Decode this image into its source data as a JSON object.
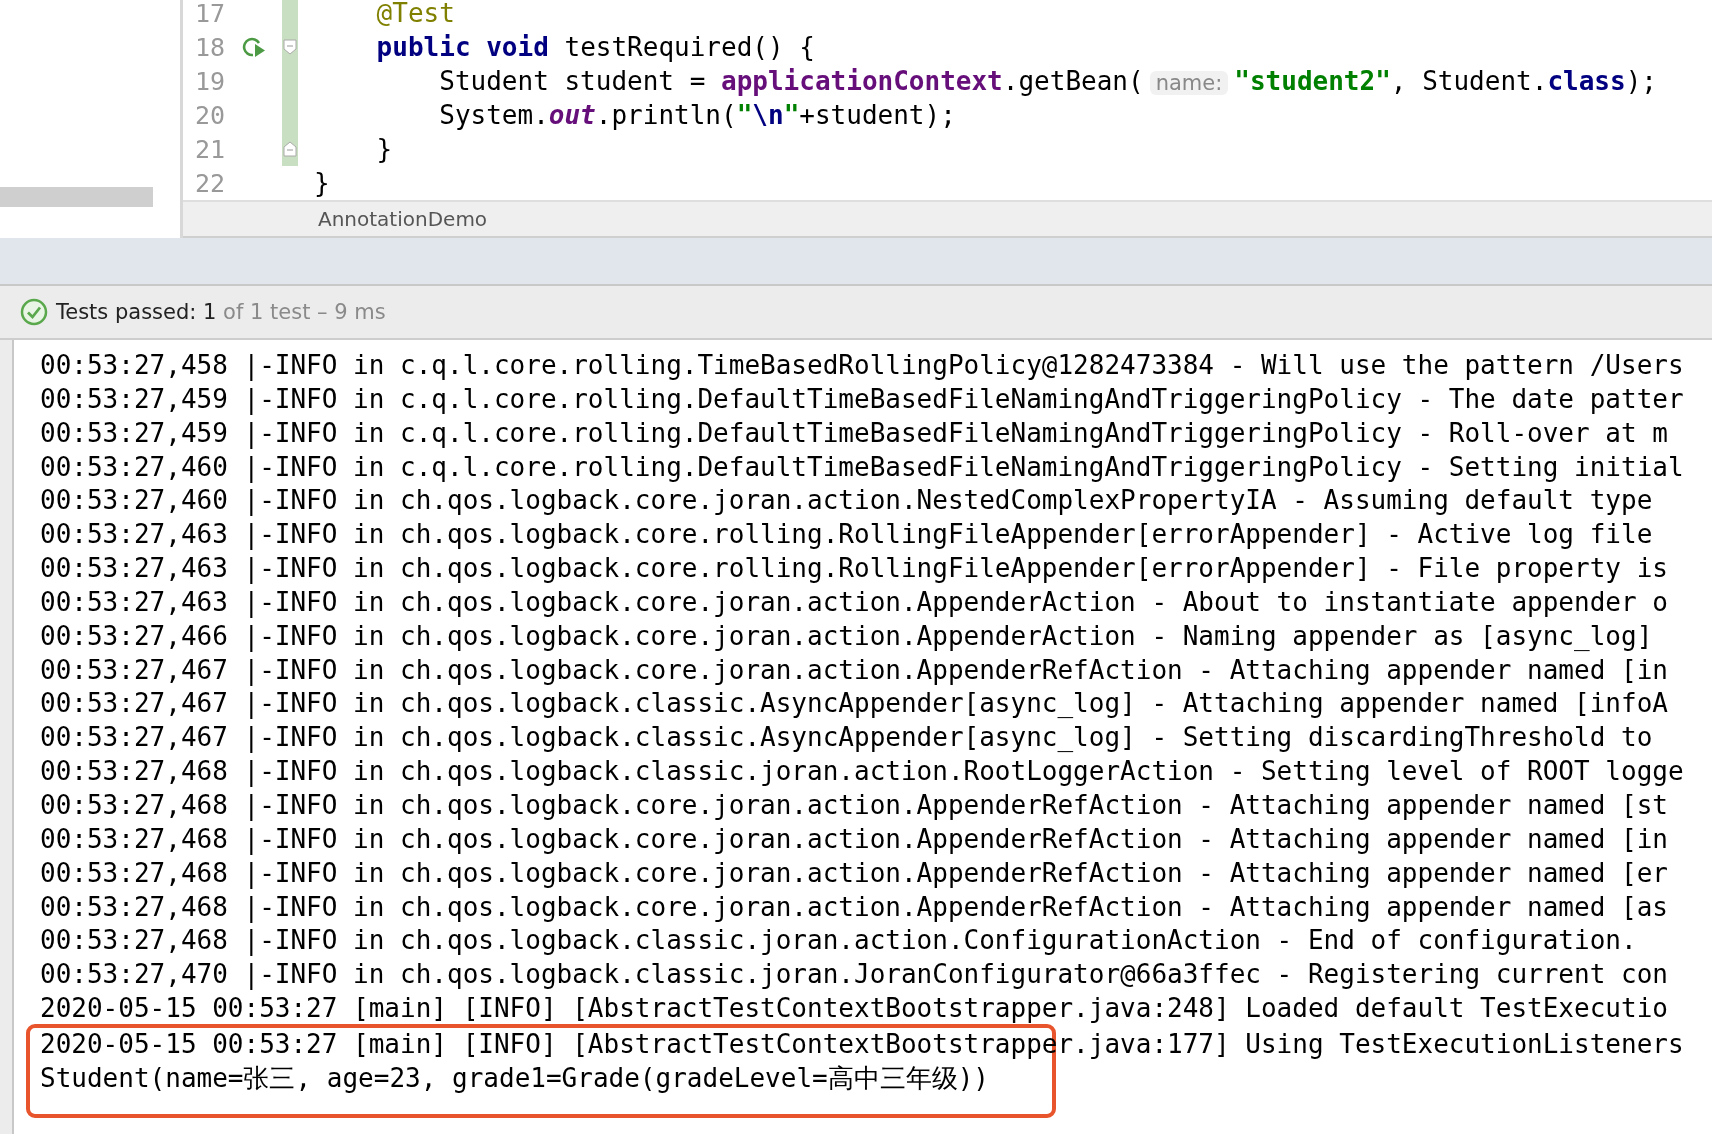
{
  "editor": {
    "lines": [
      {
        "number": "17",
        "changed": true,
        "run_icon": false,
        "fold_open": false,
        "fold_close": false,
        "tokens": [
          {
            "kind": "annotation",
            "text": "    @Test"
          }
        ]
      },
      {
        "number": "18",
        "changed": true,
        "run_icon": true,
        "fold_open": true,
        "fold_close": false,
        "tokens": [
          {
            "kind": "keyword",
            "text": "    public"
          },
          {
            "kind": "keyword",
            "text": " void"
          },
          {
            "kind": "plain",
            "text": " testRequired() {"
          }
        ]
      },
      {
        "number": "19",
        "changed": true,
        "run_icon": false,
        "fold_open": false,
        "fold_close": false,
        "tokens": [
          {
            "kind": "plain",
            "text": "        Student student = "
          },
          {
            "kind": "field",
            "text": "applicationContext"
          },
          {
            "kind": "plain",
            "text": ".getBean("
          },
          {
            "kind": "hint",
            "text": "name:"
          },
          {
            "kind": "string",
            "text": "\"student2\""
          },
          {
            "kind": "plain",
            "text": ", Student."
          },
          {
            "kind": "keyword",
            "text": "class"
          },
          {
            "kind": "plain",
            "text": ");"
          }
        ]
      },
      {
        "number": "20",
        "changed": true,
        "run_icon": false,
        "fold_open": false,
        "fold_close": false,
        "tokens": [
          {
            "kind": "plain",
            "text": "        System."
          },
          {
            "kind": "static",
            "text": "out"
          },
          {
            "kind": "plain",
            "text": ".println("
          },
          {
            "kind": "string",
            "text": "\""
          },
          {
            "kind": "escape",
            "text": "\\n"
          },
          {
            "kind": "string",
            "text": "\""
          },
          {
            "kind": "plain",
            "text": "+student);"
          }
        ]
      },
      {
        "number": "21",
        "changed": true,
        "run_icon": false,
        "fold_open": false,
        "fold_close": true,
        "tokens": [
          {
            "kind": "plain",
            "text": "    }"
          }
        ]
      },
      {
        "number": "22",
        "changed": false,
        "run_icon": false,
        "fold_open": false,
        "fold_close": false,
        "tokens": [
          {
            "kind": "plain",
            "text": "}"
          }
        ]
      }
    ],
    "breadcrumb": "AnnotationDemo"
  },
  "test_status": {
    "passed": true,
    "label": "Tests passed:",
    "count": "1",
    "detail": "of 1 test – 9 ms"
  },
  "console": {
    "lines": [
      "00:53:27,458 |-INFO in c.q.l.core.rolling.TimeBasedRollingPolicy@1282473384 - Will use the pattern /Users",
      "00:53:27,459 |-INFO in c.q.l.core.rolling.DefaultTimeBasedFileNamingAndTriggeringPolicy - The date patter",
      "00:53:27,459 |-INFO in c.q.l.core.rolling.DefaultTimeBasedFileNamingAndTriggeringPolicy - Roll-over at m",
      "00:53:27,460 |-INFO in c.q.l.core.rolling.DefaultTimeBasedFileNamingAndTriggeringPolicy - Setting initial",
      "00:53:27,460 |-INFO in ch.qos.logback.core.joran.action.NestedComplexPropertyIA - Assuming default type",
      "00:53:27,463 |-INFO in ch.qos.logback.core.rolling.RollingFileAppender[errorAppender] - Active log file",
      "00:53:27,463 |-INFO in ch.qos.logback.core.rolling.RollingFileAppender[errorAppender] - File property is",
      "00:53:27,463 |-INFO in ch.qos.logback.core.joran.action.AppenderAction - About to instantiate appender o",
      "00:53:27,466 |-INFO in ch.qos.logback.core.joran.action.AppenderAction - Naming appender as [async_log]",
      "00:53:27,467 |-INFO in ch.qos.logback.core.joran.action.AppenderRefAction - Attaching appender named [in",
      "00:53:27,467 |-INFO in ch.qos.logback.classic.AsyncAppender[async_log] - Attaching appender named [infoA",
      "00:53:27,467 |-INFO in ch.qos.logback.classic.AsyncAppender[async_log] - Setting discardingThreshold to",
      "00:53:27,468 |-INFO in ch.qos.logback.classic.joran.action.RootLoggerAction - Setting level of ROOT logge",
      "00:53:27,468 |-INFO in ch.qos.logback.core.joran.action.AppenderRefAction - Attaching appender named [st",
      "00:53:27,468 |-INFO in ch.qos.logback.core.joran.action.AppenderRefAction - Attaching appender named [in",
      "00:53:27,468 |-INFO in ch.qos.logback.core.joran.action.AppenderRefAction - Attaching appender named [er",
      "00:53:27,468 |-INFO in ch.qos.logback.core.joran.action.AppenderRefAction - Attaching appender named [as",
      "00:53:27,468 |-INFO in ch.qos.logback.classic.joran.action.ConfigurationAction - End of configuration.",
      "00:53:27,470 |-INFO in ch.qos.logback.classic.joran.JoranConfigurator@66a3ffec - Registering current con",
      "2020-05-15 00:53:27 [main] [INFO] [AbstractTestContextBootstrapper.java:248] Loaded default TestExecutio"
    ],
    "highlighted_lines": [
      "2020-05-15 00:53:27 [main] [INFO] [AbstractTestContextBootstrapper.java:177] Using TestExecutionListeners",
      "Student(name=张三, age=23, grade1=Grade(gradeLevel=高中三年级))"
    ]
  }
}
